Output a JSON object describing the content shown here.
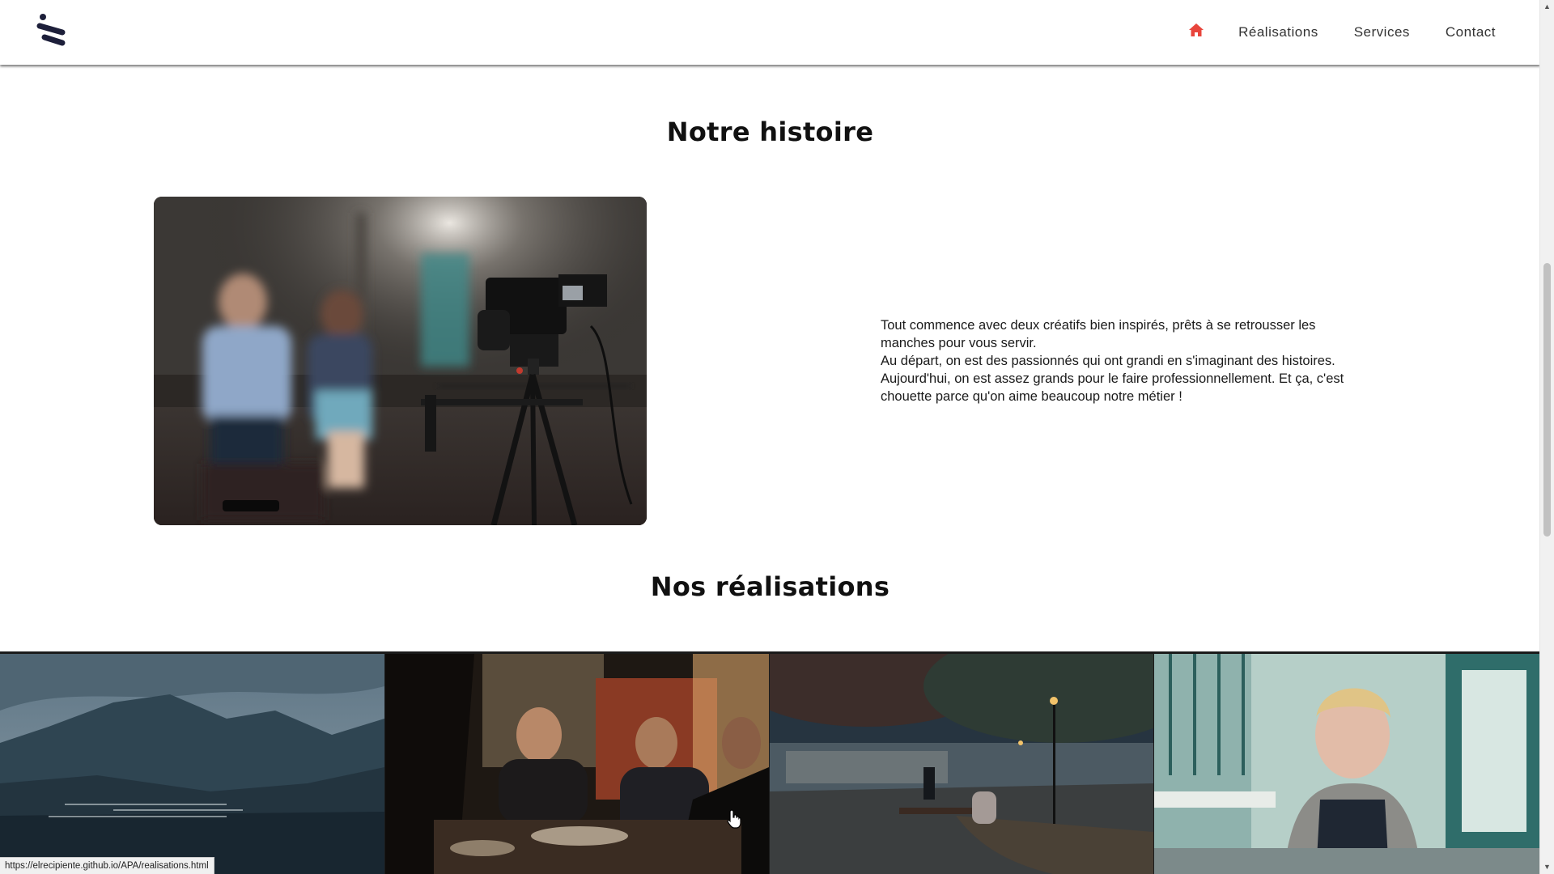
{
  "nav": {
    "home_icon": "home-icon",
    "items": [
      {
        "label": "Réalisations"
      },
      {
        "label": "Services"
      },
      {
        "label": "Contact"
      }
    ],
    "accent_color": "#e8453c"
  },
  "histoire": {
    "title": "Notre histoire",
    "photo": "interview-camera-photo",
    "paragraphs": [
      "Tout commence avec deux créatifs bien inspirés, prêts à se retrousser les manches pour vous servir.",
      "Au départ, on est des passionnés qui ont grandi en s'imaginant des histoires.",
      "Aujourd'hui, on est assez grands pour le faire professionnellement. Et ça, c'est chouette parce qu'on aime beaucoup notre métier !"
    ]
  },
  "realisations": {
    "title": "Nos réalisations",
    "tiles": [
      {
        "name": "mountain-valley-photo"
      },
      {
        "name": "dinner-table-photo"
      },
      {
        "name": "park-evening-photo"
      },
      {
        "name": "cafe-woman-photo"
      }
    ]
  },
  "status_bar": {
    "url": "https://elrecipiente.github.io/APA/realisations.html"
  }
}
